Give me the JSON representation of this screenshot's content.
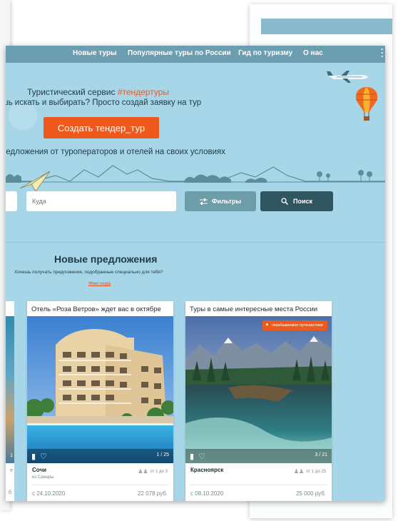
{
  "nav": {
    "items": [
      "Новые туры",
      "Популярные туры по России",
      "Гид по туризму",
      "О нас"
    ]
  },
  "hero": {
    "tagline": "Туристический сервис",
    "hashtag": "#тендертуры",
    "subline": "ешь искать и выбирать? Просто создай заявку на тур",
    "cta": "Создать тендер_тур",
    "offer_line": "редложения от туроператоров и отелей на своих условиях"
  },
  "search": {
    "to_placeholder": "Куда",
    "filters_label": "Фильтры",
    "search_label": "Поиск"
  },
  "offers": {
    "title": "Новые предложения",
    "note": "Хочешь получать предложения, подобранные специально для тебя?",
    "link": "Жми сюда"
  },
  "partial_card": {
    "counter": "1",
    "line1": "е",
    "line2": "б."
  },
  "cards": [
    {
      "title": "Отель «Роза Ветров» ждет вас в октябре",
      "counter": "1 / 25",
      "city": "Сочи",
      "from": "из Самары",
      "guests": "от 1 до 3",
      "date": "с 24.10.2020",
      "price": "22 078 руб."
    },
    {
      "title": "Туры в самые интересные места России",
      "badge": "незабываемое путешествие",
      "counter": "3 / 21",
      "city": "Красноярск",
      "guests": "от 1 до 25",
      "date": "с 08.10.2020",
      "price": "25 000 руб."
    }
  ],
  "colors": {
    "panel_bg": "#a6d6e8",
    "nav_bg": "#6a9eb0",
    "accent": "#ee5a1d",
    "search_btn": "#2e5560",
    "filters_btn": "#6c9da8"
  }
}
